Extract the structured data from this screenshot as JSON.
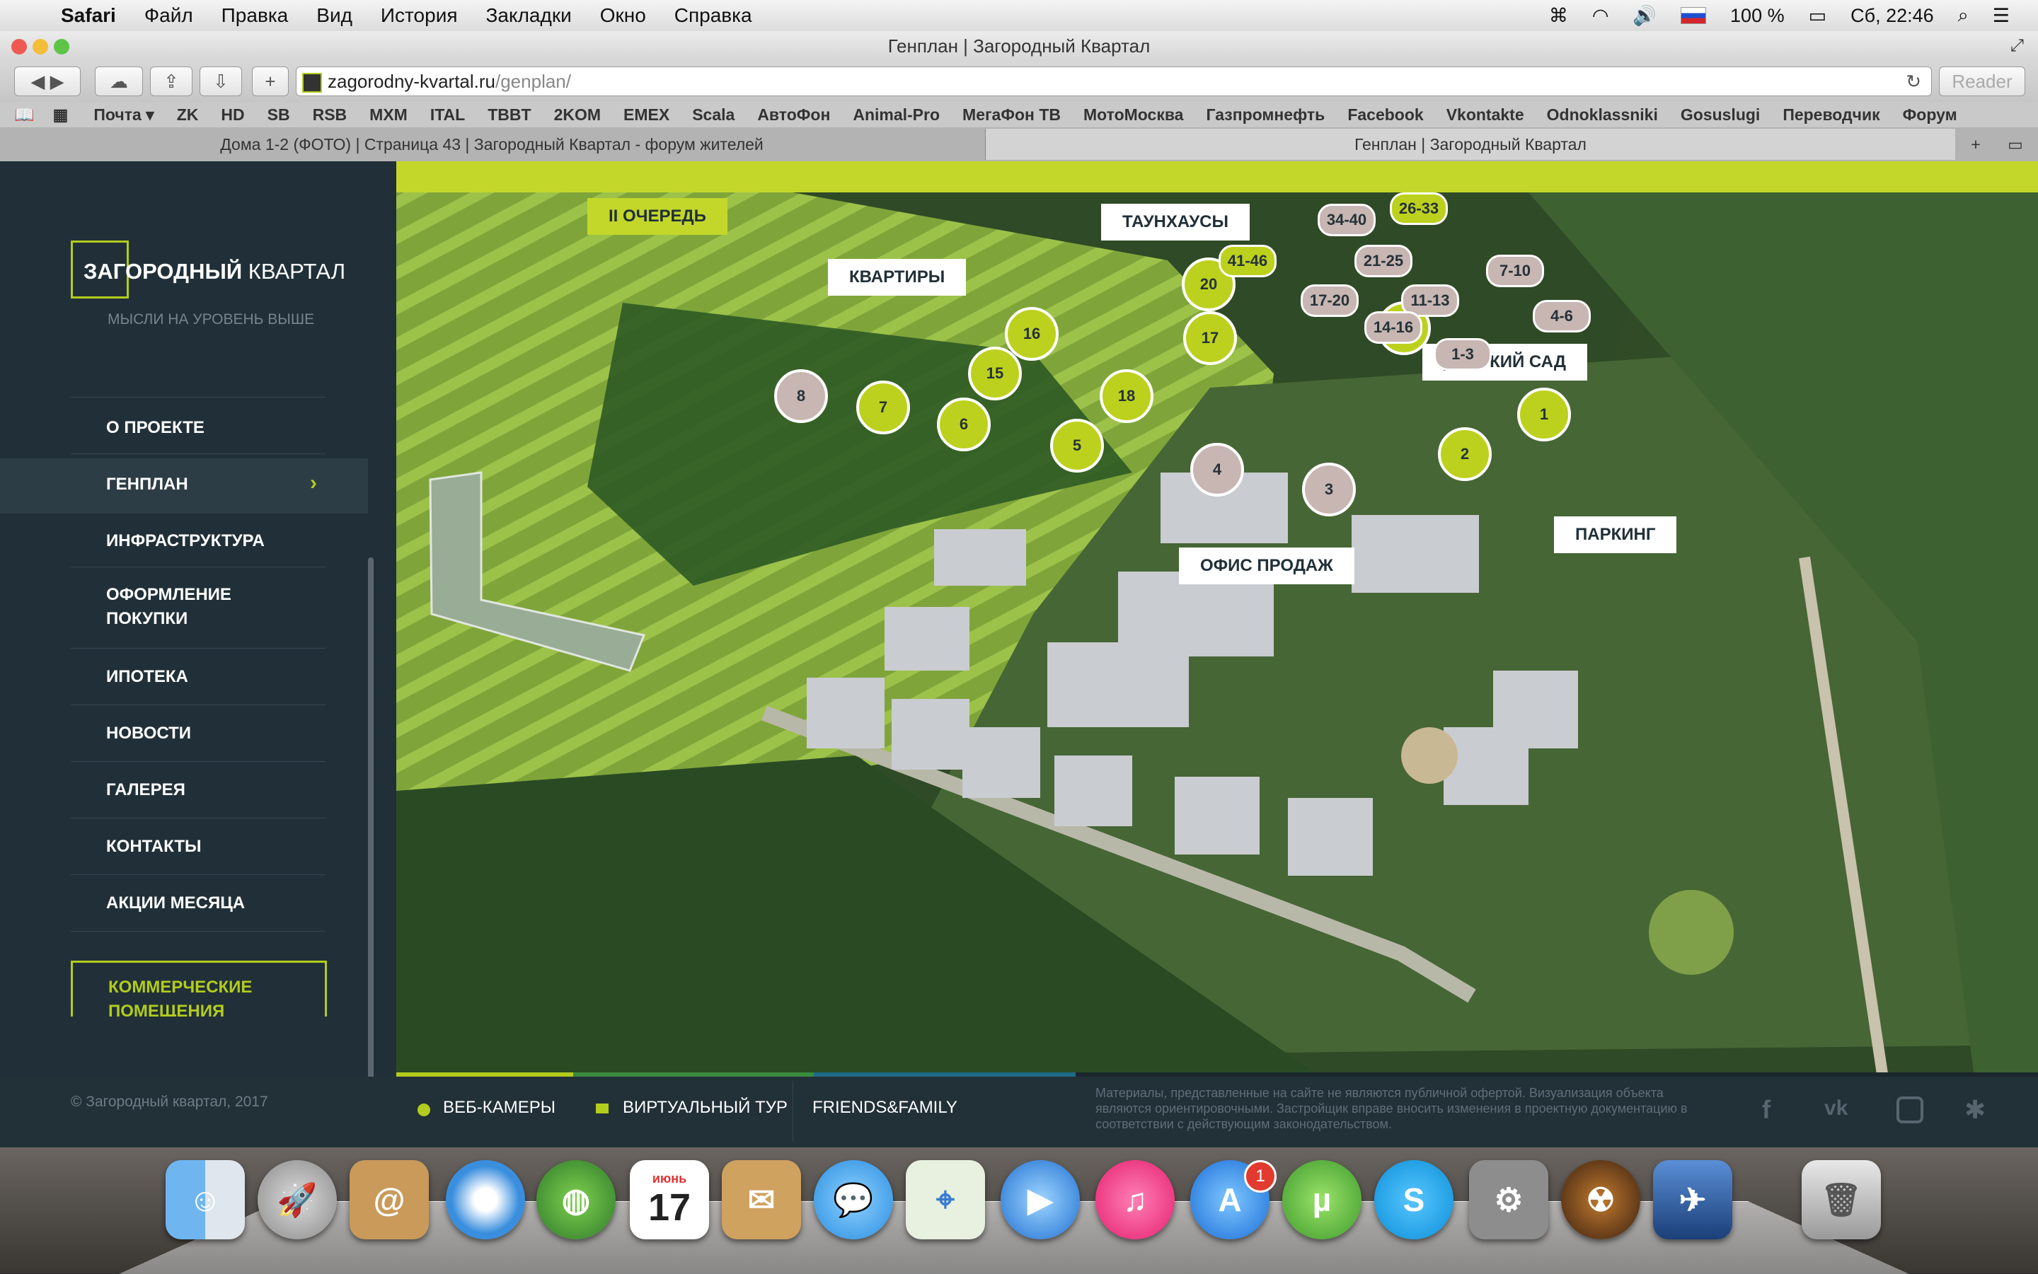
{
  "menubar": {
    "app": "Safari",
    "items": [
      "Файл",
      "Правка",
      "Вид",
      "История",
      "Закладки",
      "Окно",
      "Справка"
    ],
    "battery": "100 %",
    "clock": "Сб, 22:46"
  },
  "window": {
    "title": "Генплан | Загородный Квартал",
    "url_host": "zagorodny-kvartal.ru",
    "url_path": "/genplan/",
    "reader": "Reader"
  },
  "bookmarks": [
    "Почта ▾",
    "ZK",
    "HD",
    "SB",
    "RSB",
    "MXM",
    "ITAL",
    "TBBT",
    "2KOM",
    "EMEX",
    "Scala",
    "АвтоФон",
    "Animal-Pro",
    "МегаФон ТВ",
    "МотоМосква",
    "Газпромнефть",
    "Facebook",
    "Vkontakte",
    "Odnoklassniki",
    "Gosuslugi",
    "Переводчик",
    "Форум"
  ],
  "tabs": [
    {
      "label": "Дома 1-2 (ФОТО) | Страница 43 | Загородный Квартал - форум жителей"
    },
    {
      "label": "Генплан | Загородный Квартал"
    }
  ],
  "sidebar": {
    "logo_bold": "ЗАГОРОДНЫЙ",
    "logo_light": "КВАРТАЛ",
    "slogan": "МЫСЛИ НА УРОВЕНЬ ВЫШЕ",
    "nav": [
      {
        "label": "О ПРОЕКТЕ"
      },
      {
        "label": "ГЕНПЛАН"
      },
      {
        "label": "ИНФРАСТРУКТУРА"
      },
      {
        "label": "ОФОРМЛЕНИЕ\nПОКУПКИ"
      },
      {
        "label": "ИПОТЕКА"
      },
      {
        "label": "НОВОСТИ"
      },
      {
        "label": "ГАЛЕРЕЯ"
      },
      {
        "label": "КОНТАКТЫ"
      },
      {
        "label": "АКЦИИ МЕСЯЦА"
      }
    ],
    "commercial": "КОММЕРЧЕСКИЕ ПОМЕЩЕНИЯ",
    "copyright": "© Загородный квартал, 2017"
  },
  "map": {
    "labels": {
      "queue2": "II ОЧЕРЕДЬ",
      "townhouses": "ТАУНХАУСЫ",
      "apartments": "КВАРТИРЫ",
      "kindergarten": "ДЕТСКИЙ САД",
      "parking": "ПАРКИНГ",
      "sales": "ОФИС ПРОДАЖ"
    },
    "pins": [
      {
        "n": "16",
        "c": "lime"
      },
      {
        "n": "15",
        "c": "lime"
      },
      {
        "n": "8",
        "c": "grey"
      },
      {
        "n": "7",
        "c": "lime"
      },
      {
        "n": "6",
        "c": "lime"
      },
      {
        "n": "5",
        "c": "lime"
      },
      {
        "n": "18",
        "c": "lime"
      },
      {
        "n": "17",
        "c": "lime"
      },
      {
        "n": "20",
        "c": "lime"
      },
      {
        "n": "19",
        "c": "lime"
      },
      {
        "n": "4",
        "c": "grey"
      },
      {
        "n": "3",
        "c": "grey"
      },
      {
        "n": "2",
        "c": "lime"
      },
      {
        "n": "1",
        "c": "lime"
      }
    ],
    "house_pins": [
      {
        "n": "34-40",
        "c": "grey"
      },
      {
        "n": "26-33",
        "c": "lime"
      },
      {
        "n": "41-46",
        "c": "lime"
      },
      {
        "n": "21-25",
        "c": "grey"
      },
      {
        "n": "17-20",
        "c": "grey"
      },
      {
        "n": "11-13",
        "c": "grey"
      },
      {
        "n": "7-10",
        "c": "grey"
      },
      {
        "n": "14-16",
        "c": "grey"
      },
      {
        "n": "4-6",
        "c": "grey"
      },
      {
        "n": "1-3",
        "c": "grey"
      }
    ]
  },
  "footer": {
    "webcams": "ВЕБ-КАМЕРЫ",
    "tour": "ВИРТУАЛЬНЫЙ ТУР",
    "friends": "FRIENDS&FAMILY",
    "disclaimer": "Материалы, представленные на сайте не являются публичной офертой. Визуализация объекта являются ориентировочными. Застройщик вправе вносить изменения в проектную документацию в соответствии с действующим законодательством."
  },
  "dock": {
    "calendar_month": "июнь",
    "calendar_day": "17",
    "appstore_badge": "1"
  }
}
